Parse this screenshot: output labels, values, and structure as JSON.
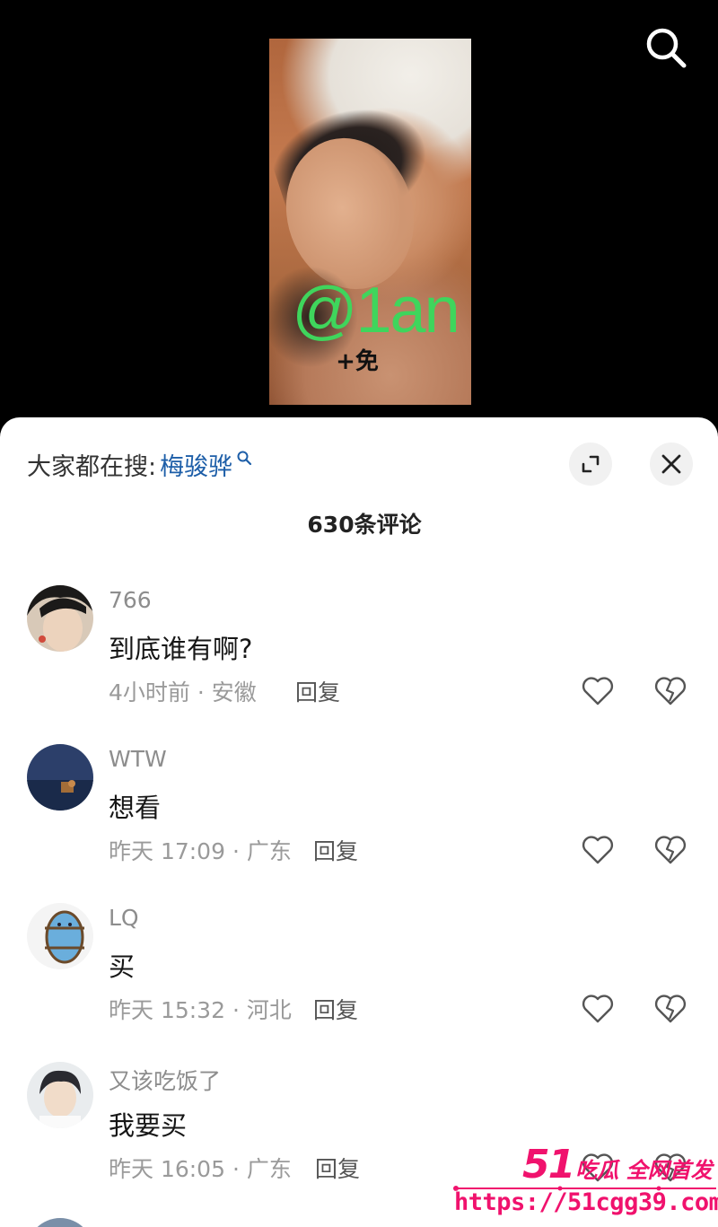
{
  "video": {
    "overlay_handle": "@1an",
    "overlay_sub": "+免"
  },
  "hot_search": {
    "label": "大家都在搜:",
    "term": "梅骏骅"
  },
  "comments_header": {
    "count_label": "630条评论"
  },
  "comments": [
    {
      "username": "766",
      "text": "到底谁有啊?",
      "meta": "4小时前 · 安徽",
      "reply_label": "回复"
    },
    {
      "username": "WTW",
      "text": "想看",
      "meta": "昨天 17:09 · 广东",
      "reply_label": "回复"
    },
    {
      "username": "LQ",
      "text": "买",
      "meta": "昨天 15:32 · 河北",
      "reply_label": "回复"
    },
    {
      "username": "又该吃饭了",
      "text": "我要买",
      "meta": "昨天 16:05 · 广东",
      "reply_label": "回复"
    }
  ],
  "watermark": {
    "brand_number": "51",
    "brand_text": "吃瓜 全网首发",
    "url": "https://51cgg39.com"
  },
  "colors": {
    "link_blue": "#1d5ea8",
    "overlay_green": "#3fd55c",
    "watermark_pink": "#f0126d",
    "meta_gray": "#9a9a9a"
  },
  "icons": [
    "search-icon",
    "expand-icon",
    "close-icon",
    "heart-icon",
    "broken-heart-icon",
    "search-small-icon"
  ]
}
